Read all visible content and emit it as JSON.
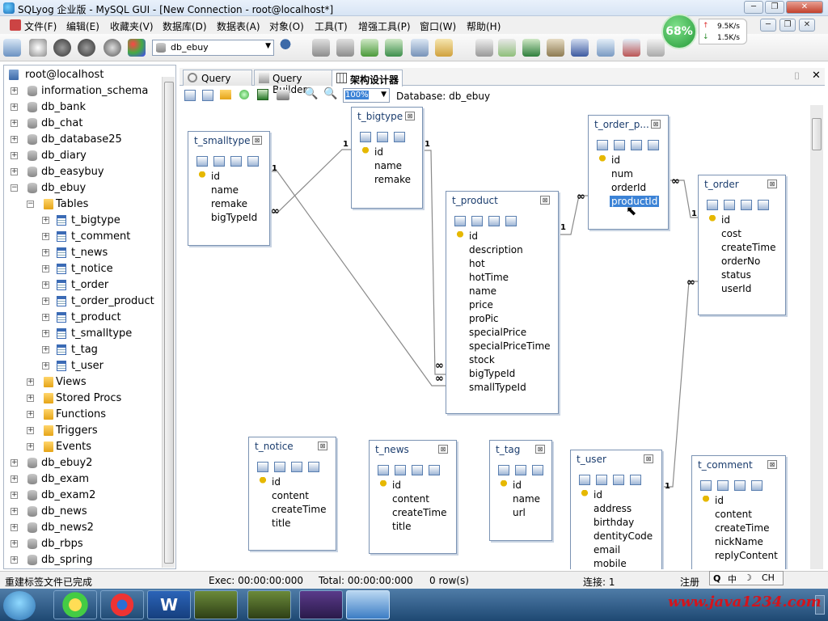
{
  "window": {
    "title": "SQLyog 企业版 - MySQL GUI - [New Connection - root@localhost*]"
  },
  "menu": [
    "文件(F)",
    "编辑(E)",
    "收藏夹(V)",
    "数据库(D)",
    "数据表(A)",
    "对象(O)",
    "工具(T)",
    "增强工具(P)",
    "窗口(W)",
    "帮助(H)"
  ],
  "toolbar": {
    "db_select": "db_ebuy"
  },
  "net": {
    "percent": "68%",
    "up": "9.5K/s",
    "down": "1.5K/s"
  },
  "tree": {
    "root": "root@localhost",
    "dbs_top": [
      "information_schema",
      "db_bank",
      "db_chat",
      "db_database25",
      "db_diary",
      "db_easybuy",
      "db_ebuy"
    ],
    "tables_label": "Tables",
    "tables": [
      "t_bigtype",
      "t_comment",
      "t_news",
      "t_notice",
      "t_order",
      "t_order_product",
      "t_product",
      "t_smalltype",
      "t_tag",
      "t_user"
    ],
    "folders": [
      "Views",
      "Stored Procs",
      "Functions",
      "Triggers",
      "Events"
    ],
    "dbs_bottom": [
      "db_ebuy2",
      "db_exam",
      "db_exam2",
      "db_news",
      "db_news2",
      "db_rbps",
      "db_spring"
    ]
  },
  "tabs": [
    "Query",
    "Query Builder",
    "架构设计器"
  ],
  "designer": {
    "zoom": "100%",
    "database_label": "Database: db_ebuy"
  },
  "entities": {
    "smalltype": {
      "title": "t_smalltype",
      "fields": [
        "id",
        "name",
        "remake",
        "bigTypeId"
      ]
    },
    "bigtype": {
      "title": "t_bigtype",
      "fields": [
        "id",
        "name",
        "remake"
      ]
    },
    "product": {
      "title": "t_product",
      "fields": [
        "id",
        "description",
        "hot",
        "hotTime",
        "name",
        "price",
        "proPic",
        "specialPrice",
        "specialPriceTime",
        "stock",
        "bigTypeId",
        "smallTypeId"
      ]
    },
    "order_product": {
      "title": "t_order_p...",
      "fields": [
        "id",
        "num",
        "orderId",
        "productId"
      ]
    },
    "order": {
      "title": "t_order",
      "fields": [
        "id",
        "cost",
        "createTime",
        "orderNo",
        "status",
        "userId"
      ]
    },
    "notice": {
      "title": "t_notice",
      "fields": [
        "id",
        "content",
        "createTime",
        "title"
      ]
    },
    "news": {
      "title": "t_news",
      "fields": [
        "id",
        "content",
        "createTime",
        "title"
      ]
    },
    "tag": {
      "title": "t_tag",
      "fields": [
        "id",
        "name",
        "url"
      ]
    },
    "user": {
      "title": "t_user",
      "fields": [
        "id",
        "address",
        "birthday",
        "dentityCode",
        "email",
        "mobile"
      ]
    },
    "comment": {
      "title": "t_comment",
      "fields": [
        "id",
        "content",
        "createTime",
        "nickName",
        "replyContent"
      ]
    }
  },
  "rel": {
    "one": "1",
    "many": "∞"
  },
  "status": {
    "msg": "重建标签文件已完成",
    "exec": "Exec: 00:00:00:000",
    "total": "Total: 00:00:00:000",
    "rows": "0 row(s)",
    "conn": "连接: 1",
    "reg": "注册"
  },
  "ime": {
    "a": "中",
    "b": "CH"
  },
  "watermark": "www.java1234.com"
}
